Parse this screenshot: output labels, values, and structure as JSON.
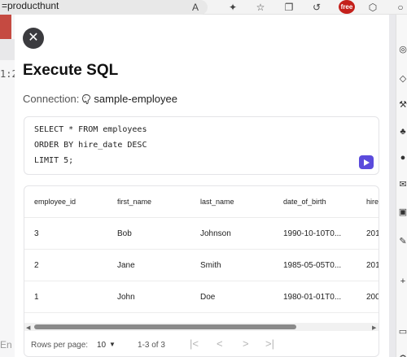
{
  "browser": {
    "url_fragment": "=producthunt",
    "badge_label": "free"
  },
  "background": {
    "time_fragment": "1:2",
    "input_fragment": "En"
  },
  "modal": {
    "title": "Execute SQL",
    "connection_label": "Connection:",
    "connection_name": "sample-employee",
    "sql_lines": [
      "SELECT * FROM employees",
      "ORDER BY hire_date DESC",
      "LIMIT 5;"
    ],
    "table": {
      "columns": [
        "employee_id",
        "first_name",
        "last_name",
        "date_of_birth",
        "hire"
      ],
      "rows": [
        [
          "3",
          "Bob",
          "Johnson",
          "1990-10-10T0...",
          "201"
        ],
        [
          "2",
          "Jane",
          "Smith",
          "1985-05-05T0...",
          "201"
        ],
        [
          "1",
          "John",
          "Doe",
          "1980-01-01T0...",
          "200"
        ]
      ]
    },
    "pagination": {
      "rows_per_page_label": "Rows per page:",
      "rows_per_page_value": "10",
      "range": "1-3 of 3"
    }
  },
  "colors": {
    "accent": "#5b4bdc",
    "close_button": "#3b3b3f"
  }
}
